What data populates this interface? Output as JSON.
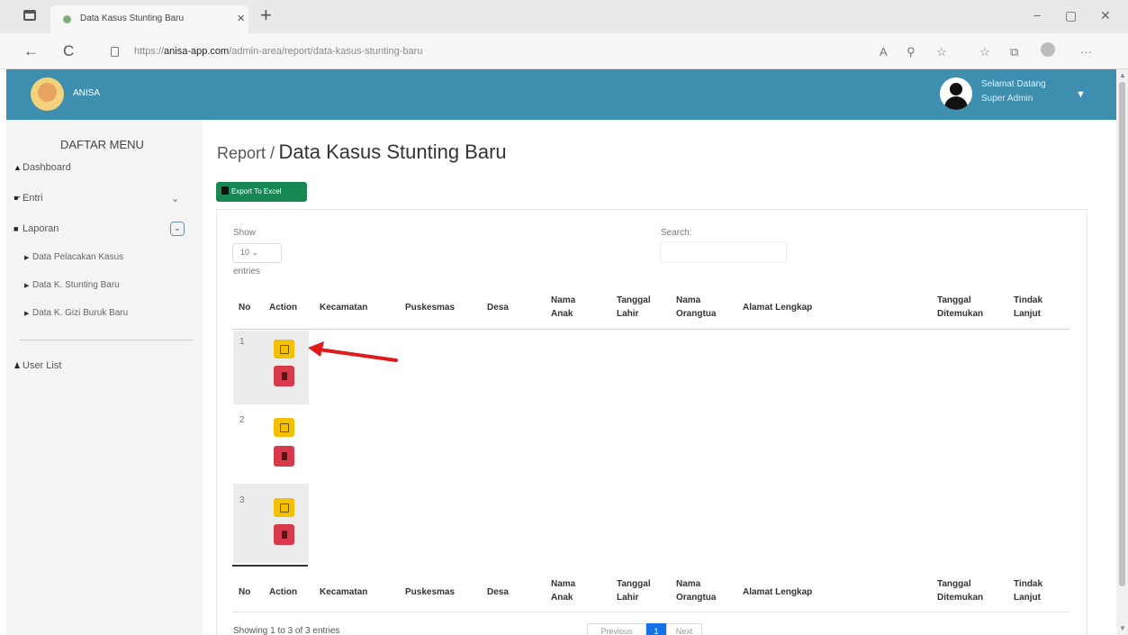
{
  "browser": {
    "tab_title": "Data Kasus Stunting Baru",
    "tab_close": "×",
    "new_tab": "+",
    "url_prefix": "https://",
    "url_host": "anisa-app.com",
    "url_path": "/admin-area/report/data-kasus-stunting-baru",
    "back": "←",
    "refresh": "C",
    "minimize": "−",
    "restore": "▢",
    "close": "✕",
    "toolbar_icons": [
      "read-aloud-icon",
      "zoom-icon",
      "favorites-add-icon",
      "favorites-icon",
      "collections-icon",
      "profile-icon",
      "more-icon"
    ]
  },
  "header": {
    "brand": "ANISA",
    "greeting_line1": "Selamat Datang",
    "greeting_line2": "Super Admin",
    "color": "#3e8eb0"
  },
  "sidebar": {
    "title": "DAFTAR MENU",
    "items": [
      {
        "label": "Dashboard",
        "icon": "home-icon"
      },
      {
        "label": "Entri",
        "icon": "hand-pointer-icon"
      },
      {
        "label": "Laporan",
        "icon": "file-icon"
      },
      {
        "label": "User List",
        "icon": "users-icon"
      }
    ],
    "subitems": [
      {
        "label": "Data Pelacakan Kasus"
      },
      {
        "label": "Data K. Stunting Baru"
      },
      {
        "label": "Data K. Gizi Buruk Baru"
      }
    ]
  },
  "main": {
    "breadcrumb": "Report /",
    "title": "Data Kasus Stunting Baru",
    "export_label": "Export To Excel",
    "show_label": "Show",
    "page_length": "10",
    "entries_label": "entries",
    "search_label": "Search:",
    "columns": [
      {
        "l1": "",
        "l2": "No"
      },
      {
        "l1": "",
        "l2": "Action"
      },
      {
        "l1": "",
        "l2": "Kecamatan"
      },
      {
        "l1": "",
        "l2": "Puskesmas"
      },
      {
        "l1": "",
        "l2": "Desa"
      },
      {
        "l1": "Nama",
        "l2": "Anak"
      },
      {
        "l1": "Tanggal",
        "l2": "Lahir"
      },
      {
        "l1": "Nama",
        "l2": "Orangtua"
      },
      {
        "l1": "",
        "l2": "Alamat Lengkap"
      },
      {
        "l1": "Tanggal",
        "l2": "Ditemukan"
      },
      {
        "l1": "Tindak",
        "l2": "Lanjut"
      }
    ],
    "rows": [
      {
        "no": "1"
      },
      {
        "no": "2"
      },
      {
        "no": "3"
      }
    ],
    "info": "Showing 1 to 3 of 3 entries",
    "pagination": {
      "previous": "Previous",
      "page": "1",
      "next": "Next"
    },
    "colors": {
      "edit": "#f5c000",
      "delete": "#d83a4a",
      "export": "#198754",
      "annotation_arrow": "#e0191b"
    }
  }
}
